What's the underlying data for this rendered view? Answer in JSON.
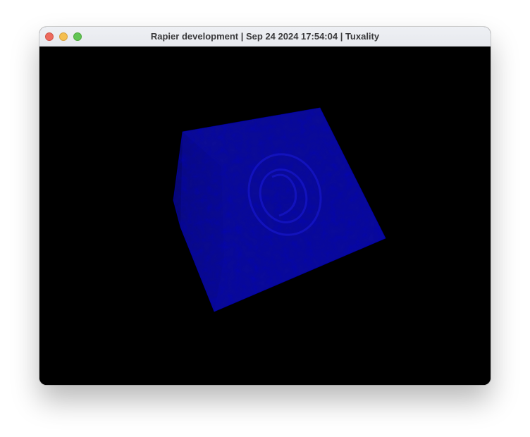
{
  "window": {
    "title": "Rapier development | Sep 24 2024 17:54:04 | Tuxality"
  },
  "controls": {
    "close": "close-button",
    "minimize": "minimize-button",
    "zoom": "zoom-button"
  },
  "scene": {
    "background_color": "#000000",
    "cube_color": "#0a0aa8",
    "cube_shade_color": "#06067a"
  }
}
